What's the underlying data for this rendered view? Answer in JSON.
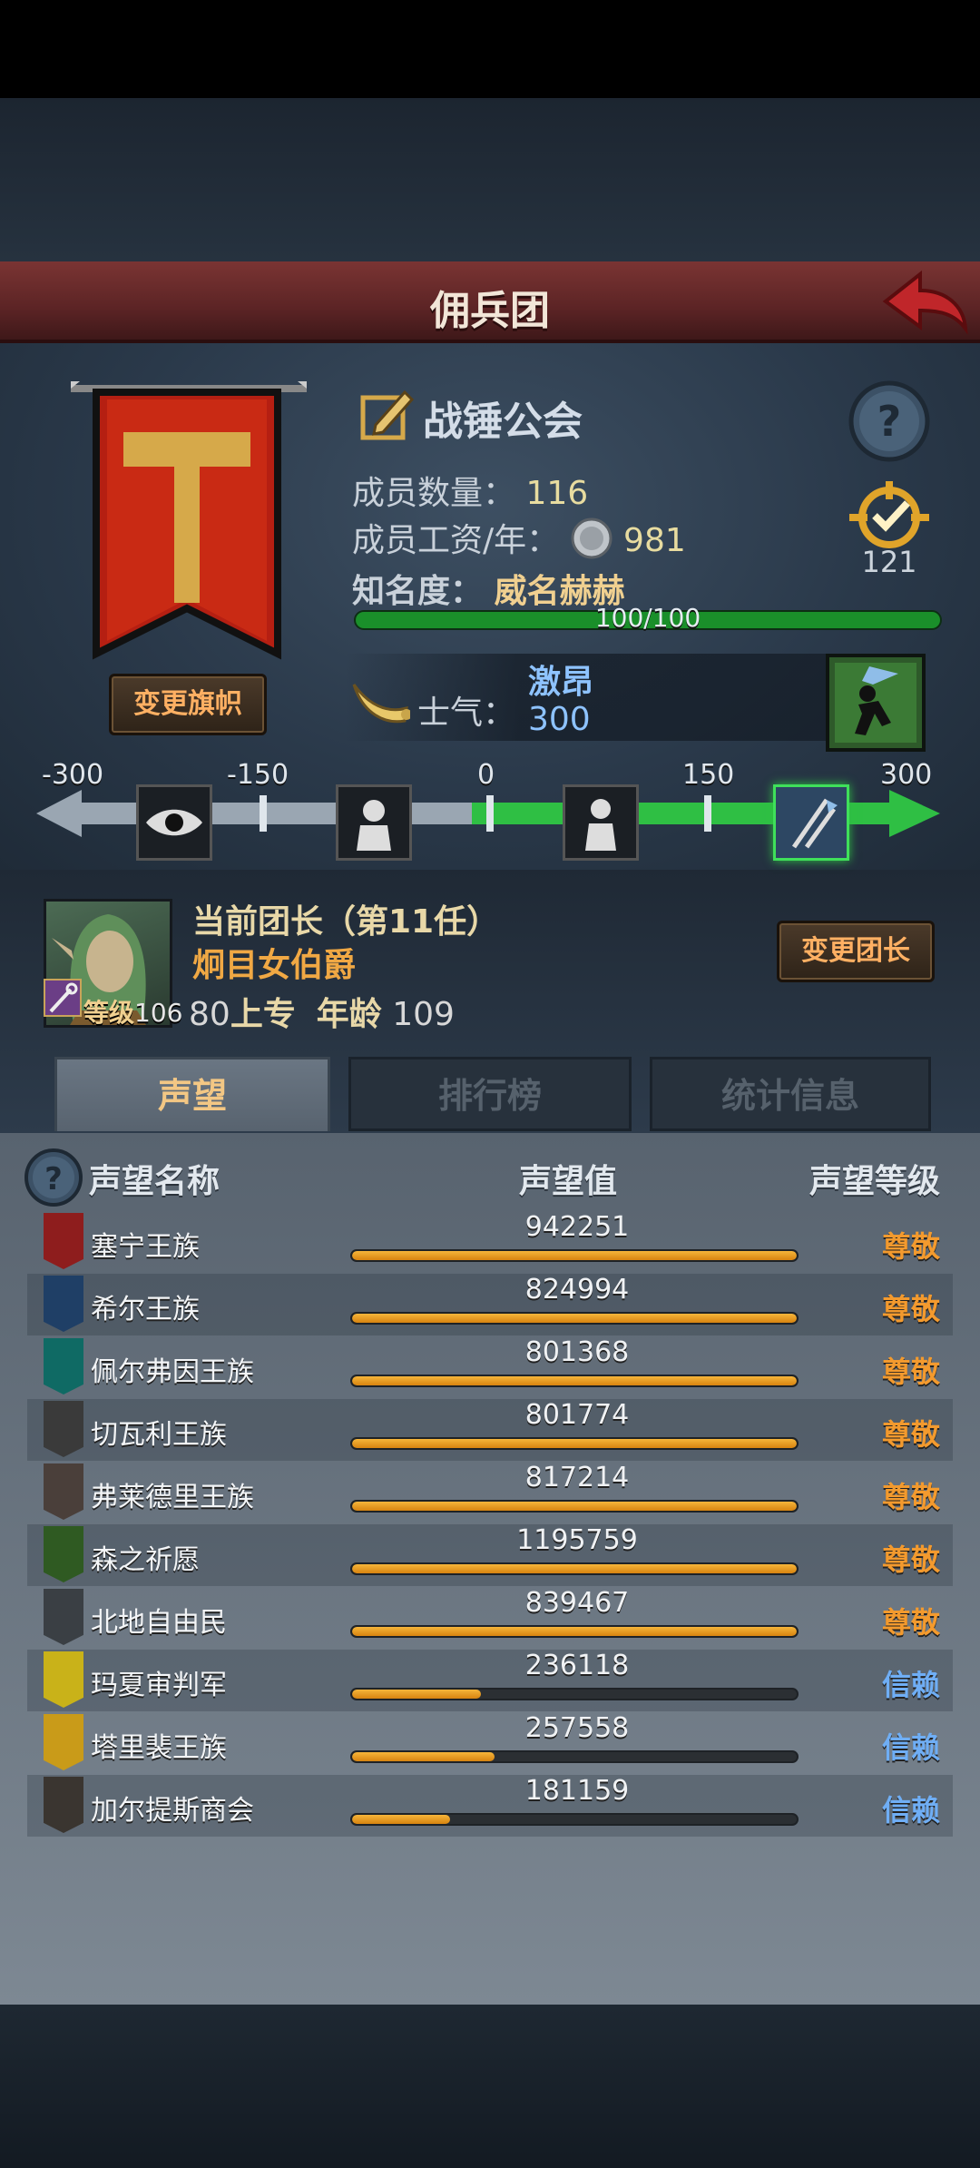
{
  "header": {
    "title": "佣兵团"
  },
  "flag": {
    "change_label": "变更旗帜"
  },
  "guild": {
    "name": "战锤公会",
    "member_label": "成员数量：",
    "member_value": "116",
    "wage_label": "成员工资/年：",
    "wage_value": "981",
    "fame_label": "知名度：",
    "fame_value": "威名赫赫",
    "fame_progress_text": "100/100",
    "fame_progress": 1.0,
    "rank_number": "121"
  },
  "morale": {
    "label": "士气：",
    "state": "激昂",
    "value": "300",
    "scale_labels": [
      "-300",
      "-150",
      "0",
      "150",
      "300"
    ]
  },
  "leader": {
    "title": "当前团长（第11任）",
    "name": "炯目女伯爵",
    "level_label": "等级",
    "level_value": "106",
    "stat_num": "80",
    "stat_word": "上专",
    "age_label": "年龄",
    "age_value": "109",
    "change_label": "变更团长"
  },
  "tabs": [
    {
      "label": "声望",
      "active": true
    },
    {
      "label": "排行榜",
      "active": false
    },
    {
      "label": "统计信息",
      "active": false
    }
  ],
  "reputation": {
    "headers": {
      "name": "声望名称",
      "value": "声望值",
      "level": "声望等级"
    },
    "rows": [
      {
        "name": "塞宁王族",
        "value": "942251",
        "level": "尊敬",
        "fill": 1.0,
        "emblem_color": "#8e1d1d"
      },
      {
        "name": "希尔王族",
        "value": "824994",
        "level": "尊敬",
        "fill": 1.0,
        "emblem_color": "#1f3f66"
      },
      {
        "name": "佩尔弗因王族",
        "value": "801368",
        "level": "尊敬",
        "fill": 1.0,
        "emblem_color": "#0f6a64"
      },
      {
        "name": "切瓦利王族",
        "value": "801774",
        "level": "尊敬",
        "fill": 1.0,
        "emblem_color": "#3a3a3a"
      },
      {
        "name": "弗莱德里王族",
        "value": "817214",
        "level": "尊敬",
        "fill": 1.0,
        "emblem_color": "#4a3f3a"
      },
      {
        "name": "森之祈愿",
        "value": "1195759",
        "level": "尊敬",
        "fill": 1.0,
        "emblem_color": "#2f5a22"
      },
      {
        "name": "北地自由民",
        "value": "839467",
        "level": "尊敬",
        "fill": 1.0,
        "emblem_color": "#3a3f44"
      },
      {
        "name": "玛夏审判军",
        "value": "236118",
        "level": "信赖",
        "fill": 0.29,
        "emblem_color": "#c9b219"
      },
      {
        "name": "塔里裴王族",
        "value": "257558",
        "level": "信赖",
        "fill": 0.32,
        "emblem_color": "#c99b19"
      },
      {
        "name": "加尔提斯商会",
        "value": "181159",
        "level": "信赖",
        "fill": 0.22,
        "emblem_color": "#3a3530"
      }
    ]
  },
  "colors": {
    "level_respect": "#f39a2e",
    "level_trust": "#6faef5"
  }
}
